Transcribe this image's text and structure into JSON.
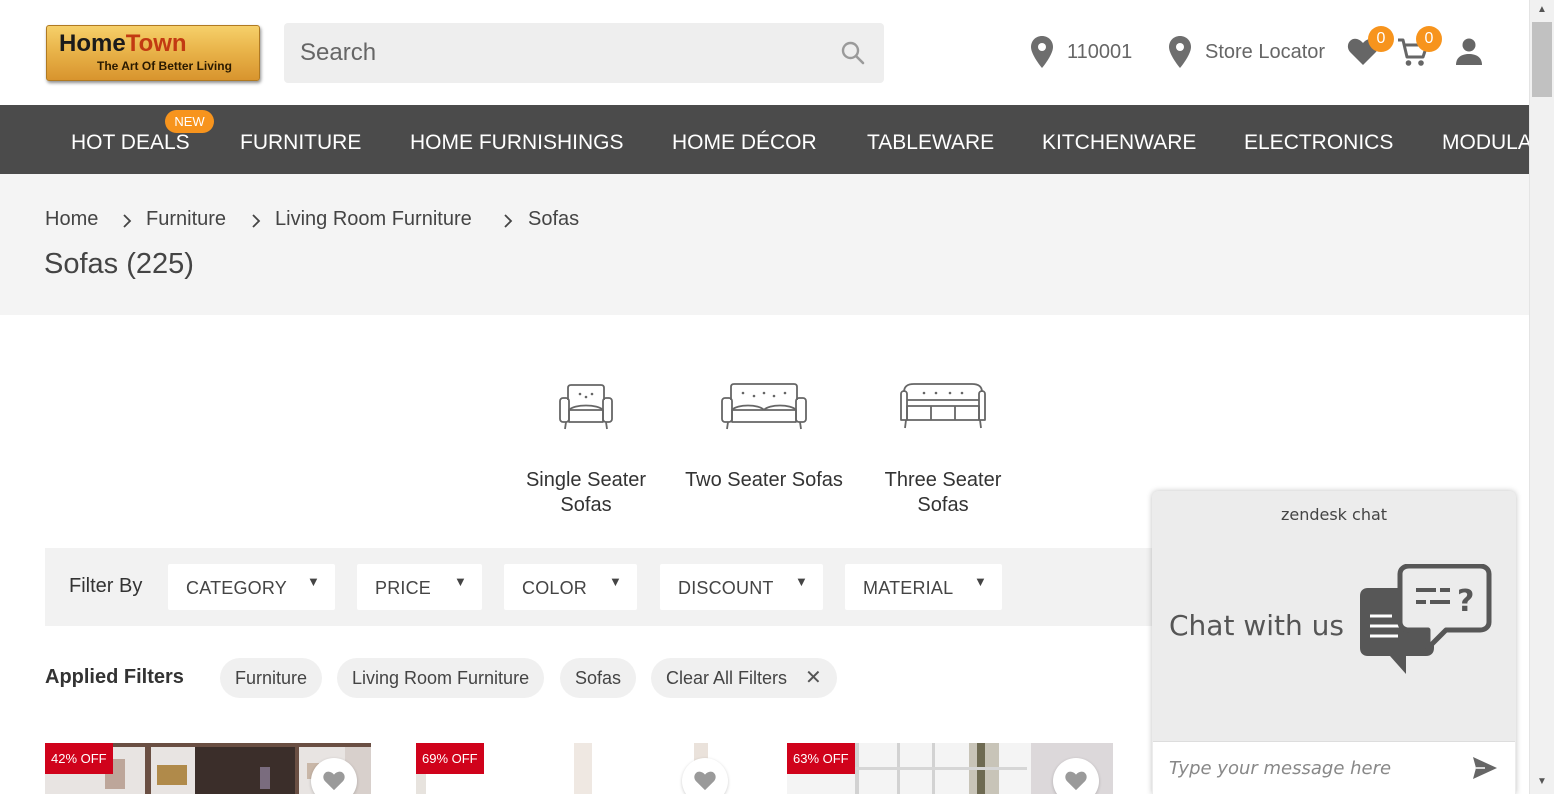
{
  "header": {
    "logo": {
      "brand_home": "Home",
      "brand_town": "Town",
      "tagline": "The Art Of Better Living"
    },
    "search": {
      "placeholder": "Search"
    },
    "pincode": "110001",
    "store_locator": "Store Locator",
    "wishlist_count": "0",
    "cart_count": "0"
  },
  "nav": {
    "new_badge": "NEW",
    "items": [
      "HOT DEALS",
      "FURNITURE",
      "HOME FURNISHINGS",
      "HOME DÉCOR",
      "TABLEWARE",
      "KITCHENWARE",
      "ELECTRONICS",
      "MODULAR"
    ]
  },
  "breadcrumb": [
    "Home",
    "Furniture",
    "Living Room Furniture",
    "Sofas"
  ],
  "page_title": "Sofas (225)",
  "categories": [
    {
      "line1": "Single Seater",
      "line2": "Sofas"
    },
    {
      "line1": "Two Seater Sofas",
      "line2": ""
    },
    {
      "line1": "Three Seater",
      "line2": "Sofas"
    }
  ],
  "filters": {
    "label": "Filter By",
    "items": [
      "CATEGORY",
      "PRICE",
      "COLOR",
      "DISCOUNT",
      "MATERIAL"
    ],
    "arrow": "▼"
  },
  "applied": {
    "label": "Applied Filters",
    "chips": [
      "Furniture",
      "Living Room Furniture",
      "Sofas"
    ],
    "clear": "Clear All Filters",
    "clear_icon": "✕"
  },
  "products": [
    {
      "discount": "42% OFF"
    },
    {
      "discount": "69% OFF"
    },
    {
      "discount": "63% OFF"
    }
  ],
  "chat": {
    "brand": "zendesk chat",
    "title": "Chat with us",
    "placeholder": "Type your message here"
  },
  "colors": {
    "accent": "#f7941d",
    "nav_bg": "#4b4b4b",
    "discount": "#d0021b"
  }
}
